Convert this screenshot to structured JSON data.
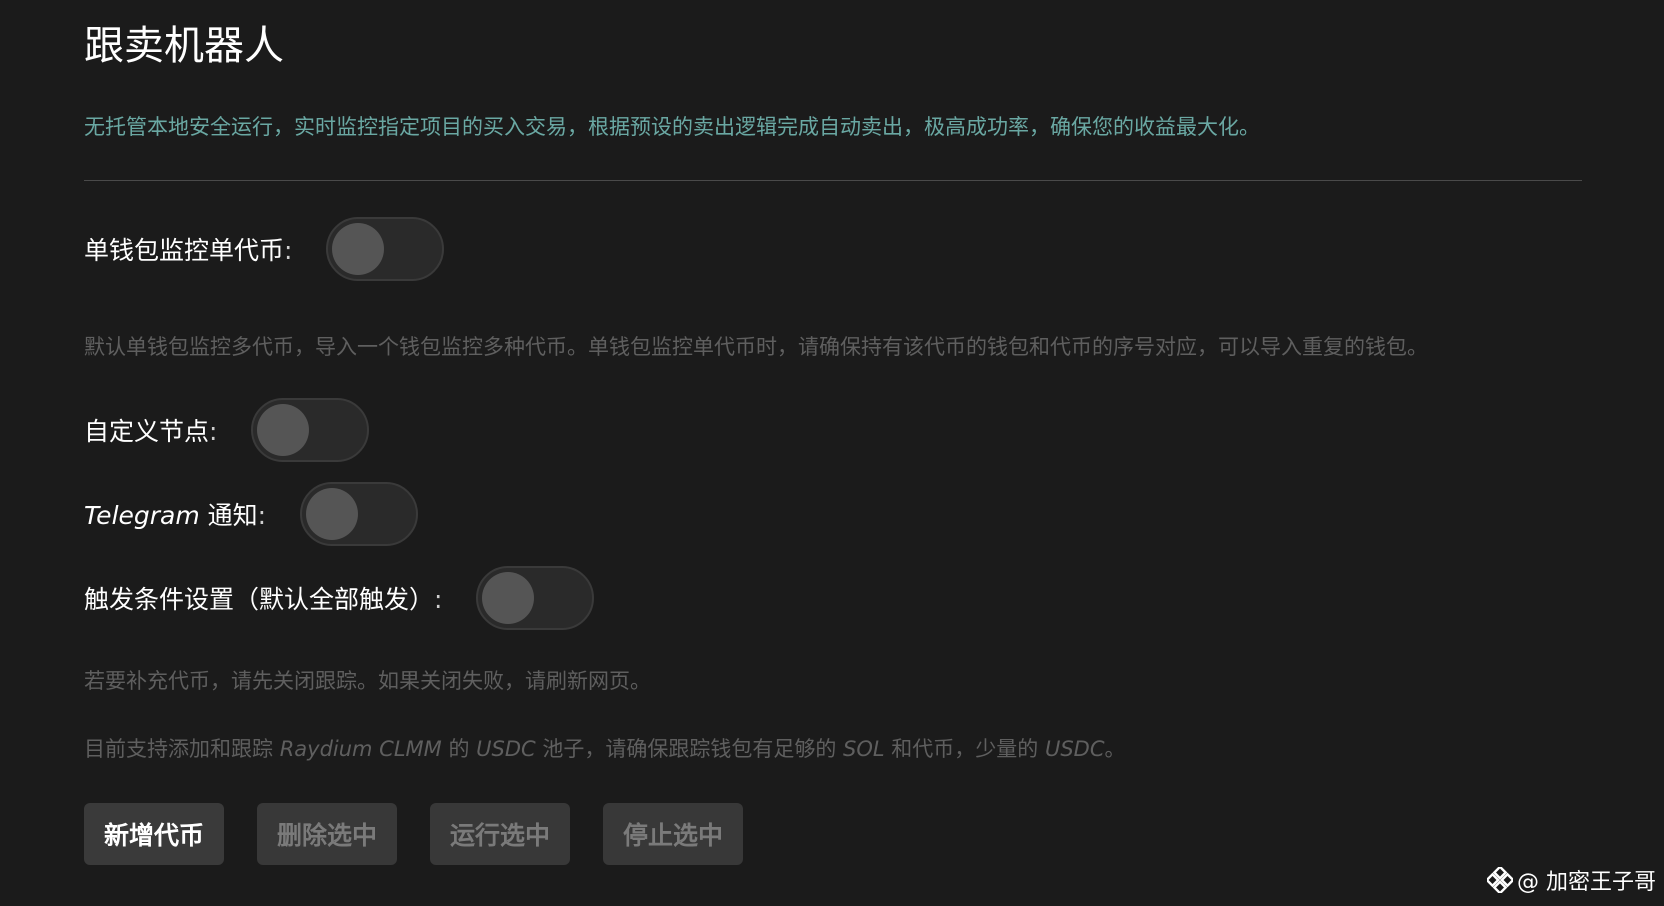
{
  "page": {
    "title": "跟卖机器人",
    "subtitle": "无托管本地安全运行，实时监控指定项目的买入交易，根据预设的卖出逻辑完成自动卖出，极高成功率，确保您的收益最大化。"
  },
  "settings": {
    "single_wallet": {
      "label": "单钱包监控单代币",
      "colon": ":",
      "enabled": false,
      "hint": "默认单钱包监控多代币，导入一个钱包监控多种代币。单钱包监控单代币时，请确保持有该代币的钱包和代币的序号对应，可以导入重复的钱包。"
    },
    "custom_node": {
      "label": "自定义节点",
      "colon": ":",
      "enabled": false
    },
    "telegram": {
      "label_en": "Telegram",
      "label": " 通知",
      "colon": ":",
      "enabled": false
    },
    "trigger": {
      "label": "触发条件设置（默认全部触发）",
      "colon": ":",
      "enabled": false
    }
  },
  "hints": {
    "refill": "若要补充代币，请先关闭跟踪。如果关闭失败，请刷新网页。",
    "support": {
      "p1": "目前支持添加和跟踪 ",
      "e1": "Raydium CLMM",
      "p2": " 的 ",
      "e2": "USDC",
      "p3": " 池子，请确保跟踪钱包有足够的 ",
      "e3": "SOL",
      "p4": " 和代币，少量的 ",
      "e4": "USDC",
      "p5": "。"
    }
  },
  "buttons": {
    "add": "新增代币",
    "delete": "删除选中",
    "run": "运行选中",
    "stop": "停止选中"
  },
  "watermark": {
    "text": "@ 加密王子哥",
    "icon": "binance-logo-icon"
  },
  "colors": {
    "background": "#1b1b1b",
    "subtitle": "#6aa8a3",
    "hint": "#5f5f5f"
  }
}
